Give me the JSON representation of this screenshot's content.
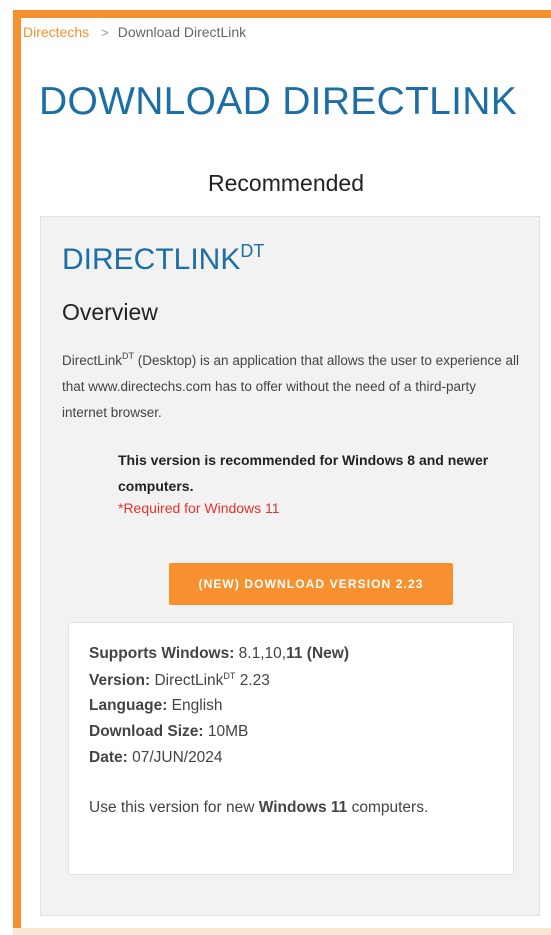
{
  "breadcrumb": {
    "home": "Directechs",
    "separator": ">",
    "current": "Download DirectLink"
  },
  "page": {
    "title": "DOWNLOAD DIRECTLINK",
    "section_heading": "Recommended"
  },
  "product": {
    "name": "DIRECTLINK",
    "name_superscript": "DT",
    "overview_heading": "Overview",
    "overview_prefix": "DirectLink",
    "overview_superscript": "DT",
    "overview_text": " (Desktop) is an application that allows the user to experience all that www.directechs.com has to offer without the need of a third-party internet browser.",
    "recommend_note": "This version is recommended for Windows 8 and newer computers.",
    "required_note": "*Required for Windows 11",
    "download_label": "(NEW) DOWNLOAD VERSION 2.23"
  },
  "info": {
    "supports_label": "Supports Windows:",
    "supports_value": " 8.1,10,",
    "supports_bold": "11 (New)",
    "version_label": "Version:",
    "version_prefix": " DirectLink",
    "version_superscript": "DT",
    "version_number": " 2.23",
    "language_label": "Language:",
    "language_value": " English",
    "size_label": "Download Size:",
    "size_value": " 10MB",
    "date_label": "Date:",
    "date_value": " 07/JUN/2024",
    "usage_prefix": "Use this version for new ",
    "usage_bold": "Windows 11",
    "usage_suffix": " computers."
  },
  "colors": {
    "accent": "#f7912f",
    "heading_blue": "#1b6ea6",
    "warning_red": "#e0342f",
    "card_background": "#f2f2f2"
  }
}
